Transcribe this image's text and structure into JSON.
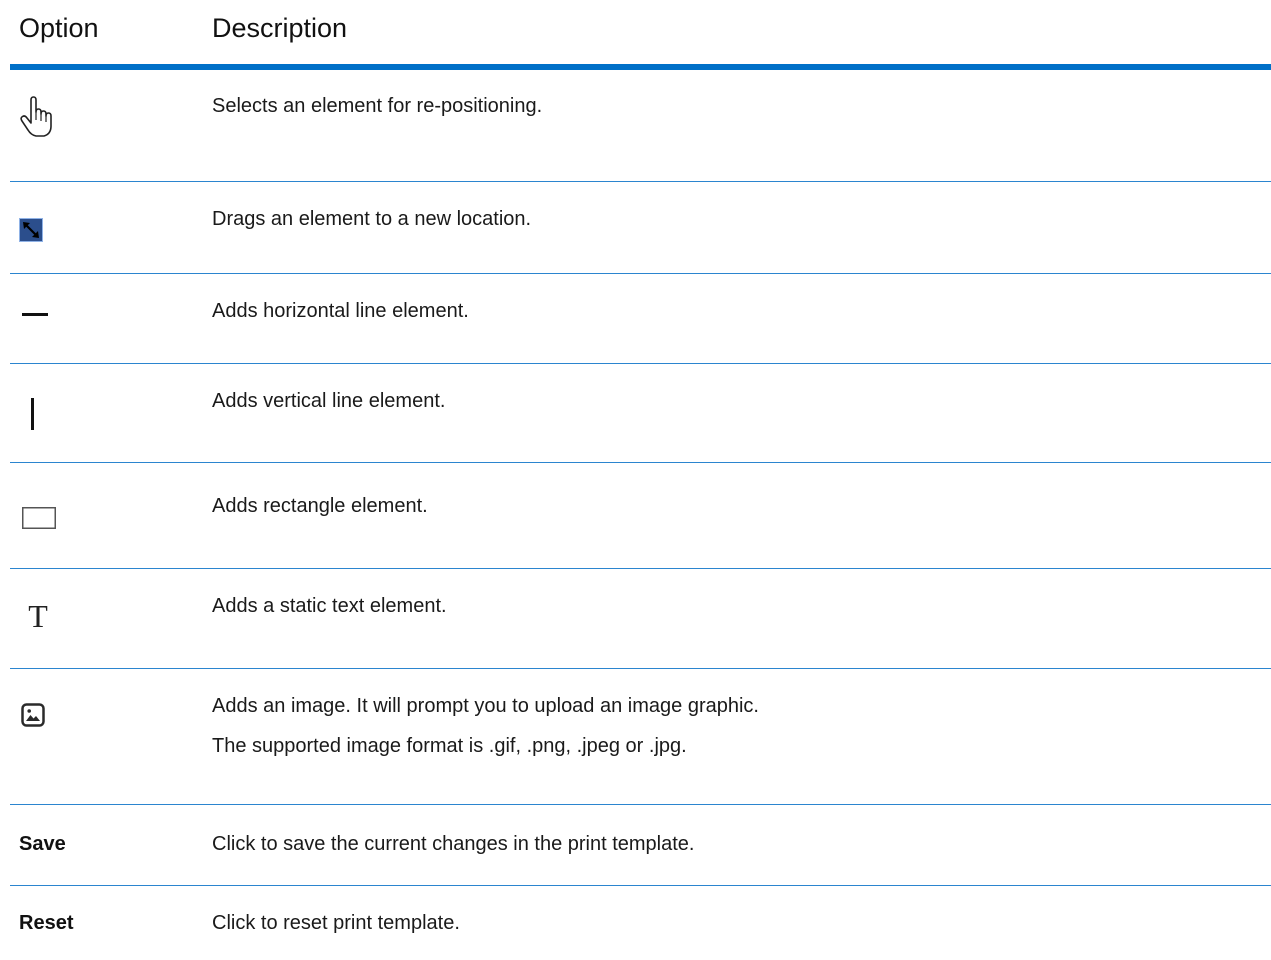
{
  "header": {
    "option": "Option",
    "description": "Description"
  },
  "rows": [
    {
      "icon": "hand-pointer-icon",
      "description": "Selects an element for re-positioning."
    },
    {
      "icon": "drag-arrows-icon",
      "description": "Drags an element to a new location."
    },
    {
      "icon": "horizontal-line-icon",
      "description": "Adds horizontal line element."
    },
    {
      "icon": "vertical-line-icon",
      "description": "Adds vertical line element."
    },
    {
      "icon": "rectangle-icon",
      "description": "Adds rectangle element."
    },
    {
      "icon": "text-t-icon",
      "description": "Adds a static text element."
    },
    {
      "icon": "image-icon",
      "description": "Adds an image. It will prompt you to upload an image graphic.",
      "description_2": "The supported image format is .gif, .png, .jpeg or .jpg."
    },
    {
      "label": "Save",
      "description": "Click to save the current changes in the print template."
    },
    {
      "label": "Reset",
      "description": "Click to reset print template."
    }
  ],
  "colors": {
    "header_rule": "#0070c8",
    "row_rule": "#2b85cf",
    "drag_icon_fill": "#2b4e8c"
  }
}
